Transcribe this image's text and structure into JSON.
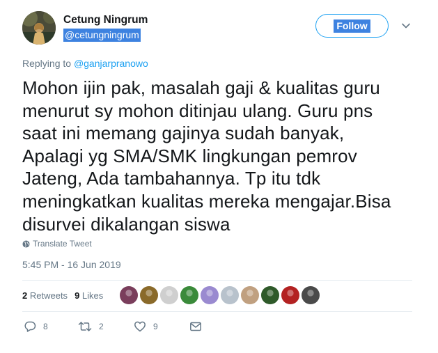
{
  "user": {
    "name": "Cetung Ningrum",
    "handle": "@cetungningrum"
  },
  "follow_label": "Follow",
  "reply": {
    "prefix": "Replying to",
    "to": "@ganjarpranowo"
  },
  "text": "Mohon ijin pak,  masalah gaji & kualitas guru\nmenurut sy mohon ditinjau ulang. Guru pns\nsaat ini memang gajinya sudah banyak,\nApalagi yg SMA/SMK lingkungan pemrov\nJateng, Ada tambahannya. Tp itu tdk\nmeningkatkan kualitas mereka mengajar.Bisa\ndisurvei dikalangan siswa",
  "translate_label": "Translate Tweet",
  "timestamp": "5:45 PM - 16 Jun 2019",
  "stats": {
    "retweets_count": "2",
    "retweets_label": "Retweets",
    "likes_count": "9",
    "likes_label": "Likes"
  },
  "liker_colors": [
    "#7a3e5c",
    "#8a6a2a",
    "#cfcfcf",
    "#3a8a3a",
    "#9a8ad0",
    "#b8c2cc",
    "#c0a080",
    "#2f5a2a",
    "#b32222",
    "#4a4a4a"
  ],
  "actions": {
    "reply_count": "8",
    "retweet_count": "2",
    "like_count": "9"
  },
  "colors": {
    "accent": "#1da1f2",
    "muted": "#657786",
    "highlight": "#3d82e0"
  }
}
